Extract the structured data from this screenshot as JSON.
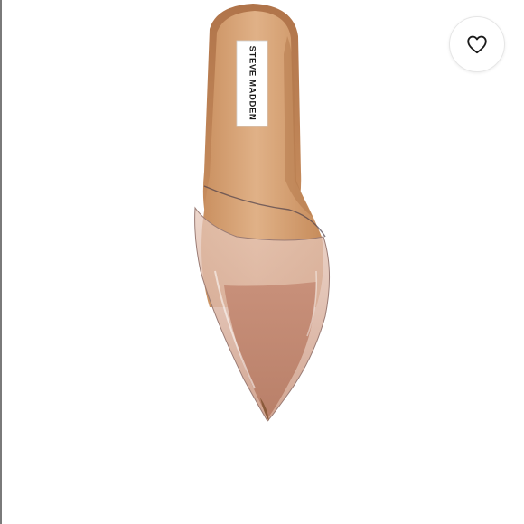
{
  "product": {
    "brand_label": "STEVE MADDEN"
  },
  "actions": {
    "like_icon": "heart-outline-icon"
  },
  "colors": {
    "background": "#ffffff",
    "insole": "#d9a878",
    "clear_vinyl": "#e3bcab",
    "toe": "#c9957d",
    "label": "#ffffff",
    "heart_stroke": "#1a1a1a"
  }
}
